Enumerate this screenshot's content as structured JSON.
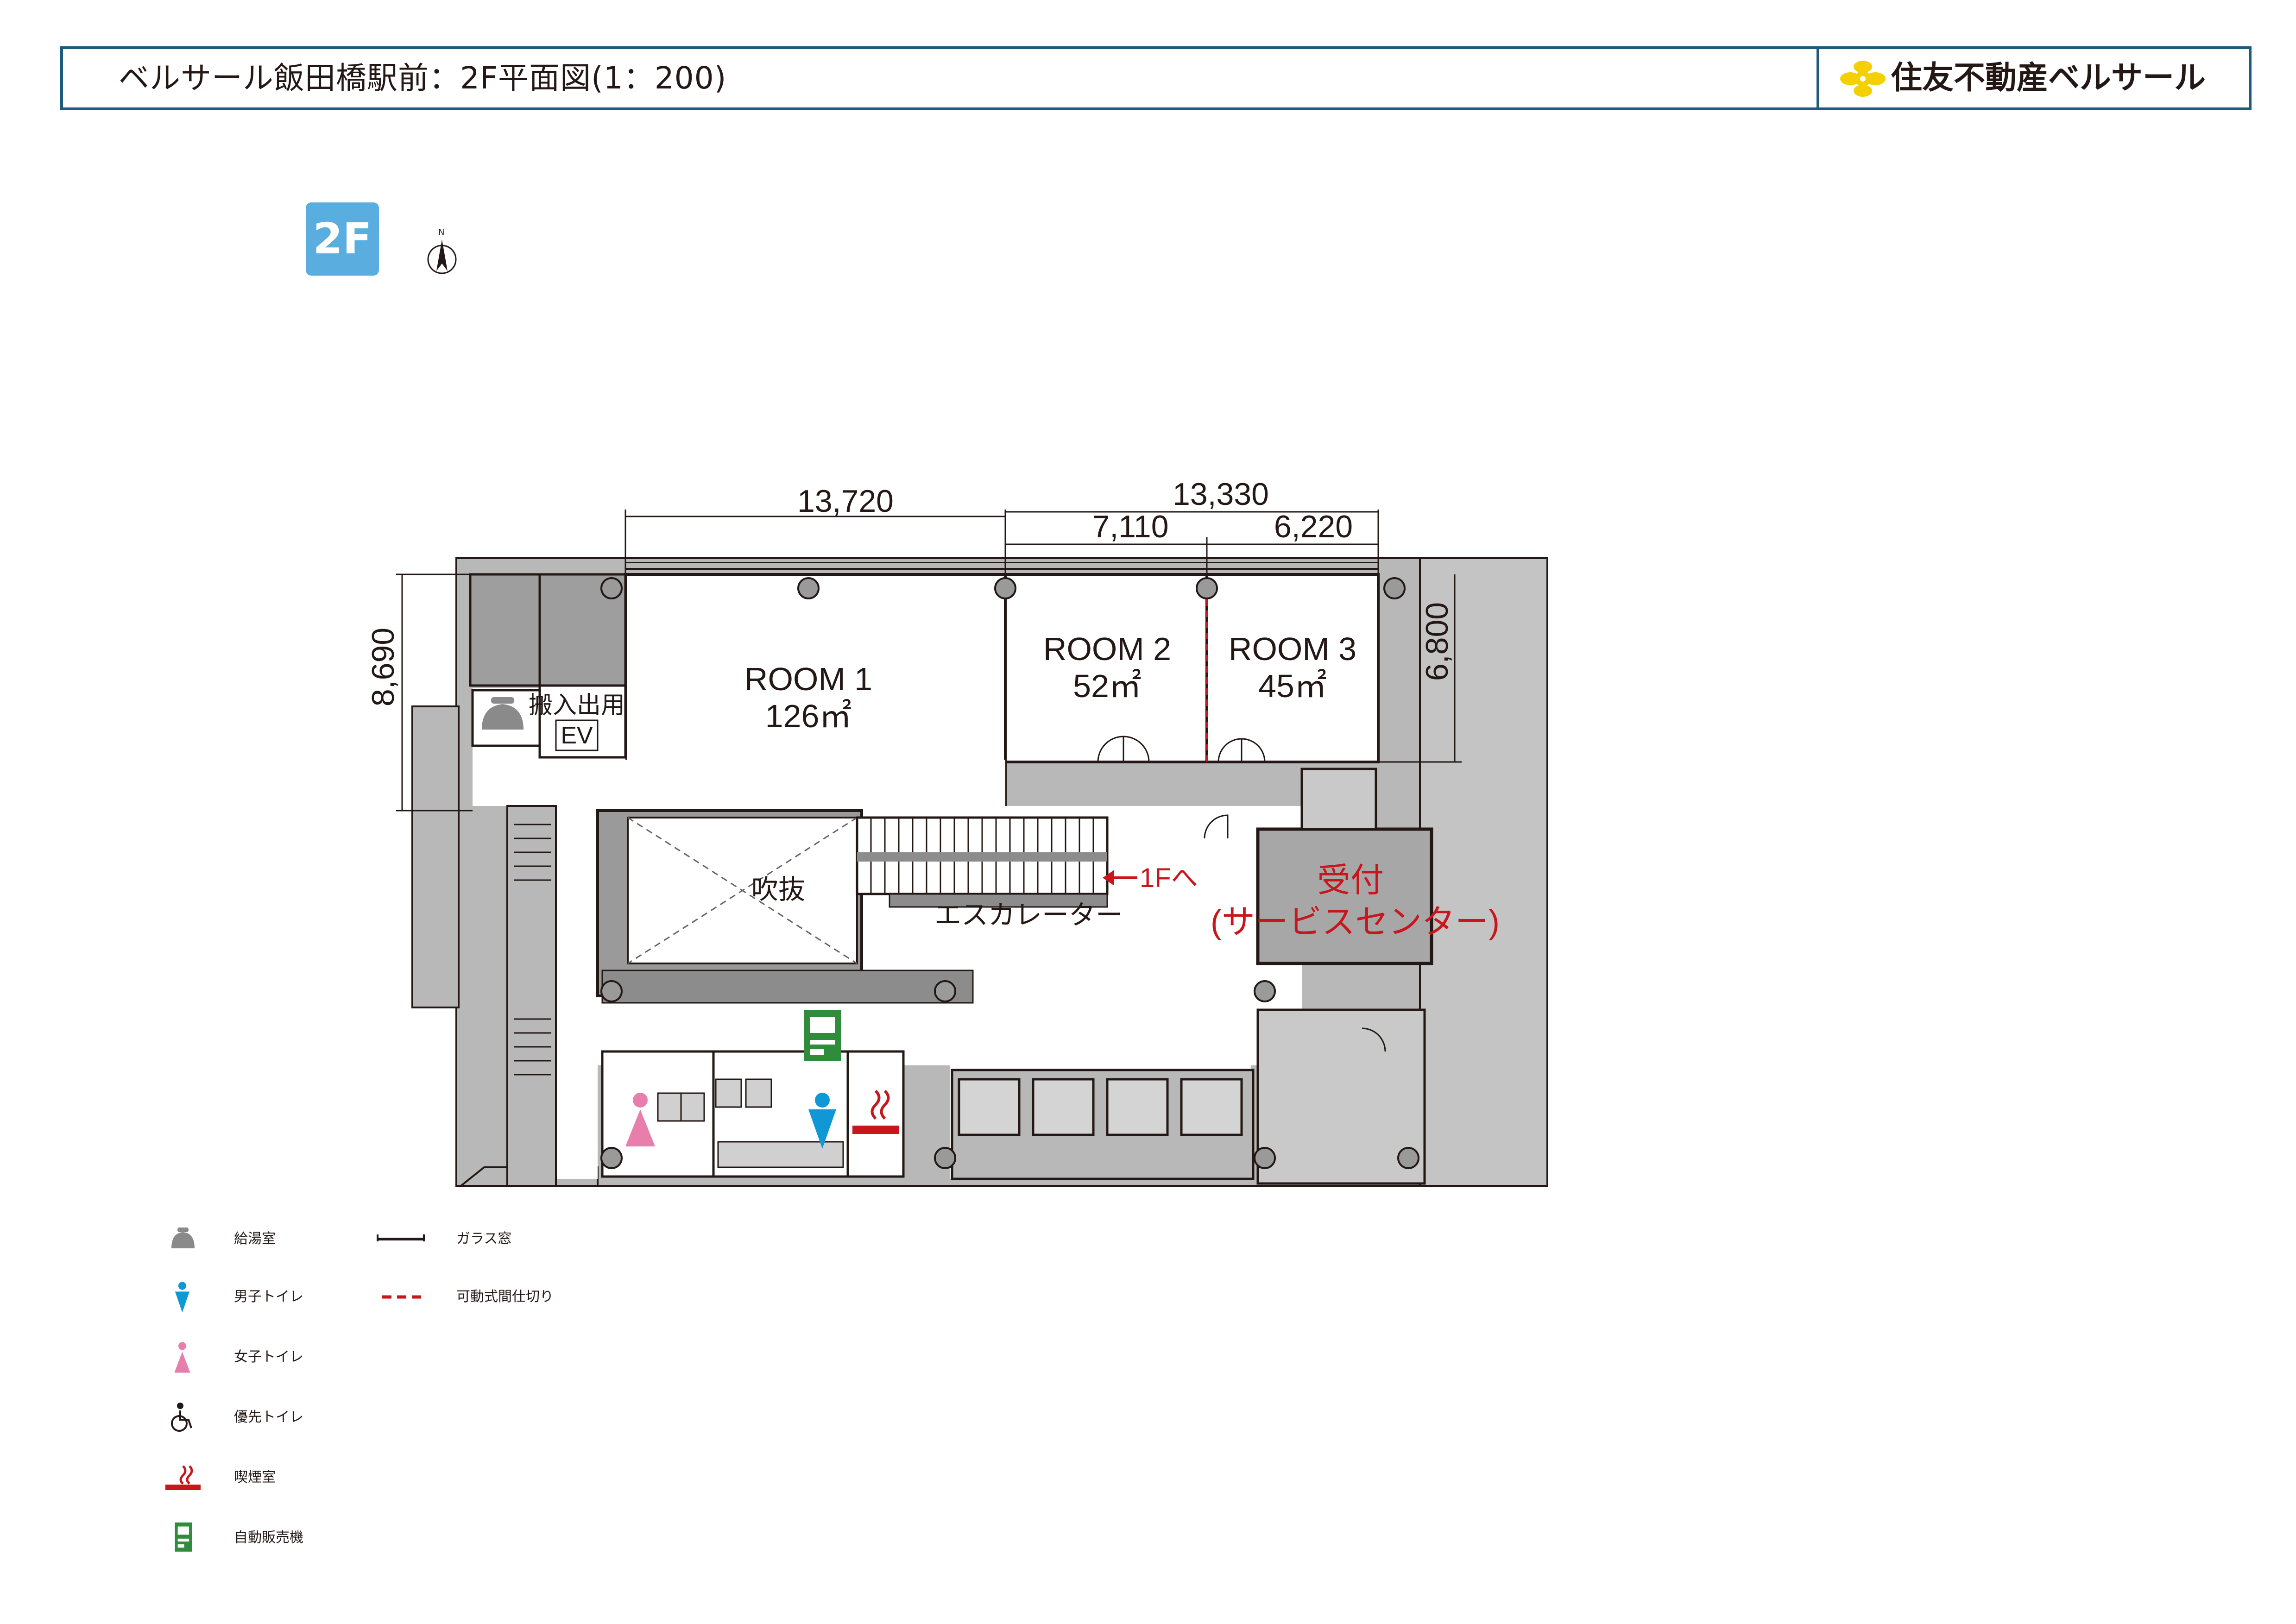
{
  "header": {
    "title": "ベルサール飯田橋駅前：2F平面図(1：200)",
    "brand_name": "住友不動産ベルサール"
  },
  "floor_badge": "2F",
  "compass": {
    "north_label": "N"
  },
  "dimensions": {
    "room1_width": "13,720",
    "room23_total_width": "13,330",
    "room2_width": "7,110",
    "room3_width": "6,220",
    "left_depth": "8,690",
    "right_depth": "6,800"
  },
  "rooms": {
    "room1_name": "ROOM 1",
    "room1_area": "126㎡",
    "room2_name": "ROOM 2",
    "room2_area": "52㎡",
    "room3_name": "ROOM 3",
    "room3_area": "45㎡"
  },
  "labels": {
    "freight_ev_line1": "搬入出用",
    "freight_ev_line2": "EV",
    "atrium": "吹抜",
    "escalator": "エスカレーター",
    "to_1f": "1Fへ",
    "reception_line1": "受付",
    "reception_line2": "(サービスセンター)"
  },
  "legend": [
    {
      "icon": "kettle-icon",
      "label": "給湯室"
    },
    {
      "icon": "men-toilet-icon",
      "label": "男子トイレ"
    },
    {
      "icon": "women-toilet-icon",
      "label": "女子トイレ"
    },
    {
      "icon": "wheelchair-icon",
      "label": "優先トイレ"
    },
    {
      "icon": "smoking-icon",
      "label": "喫煙室"
    },
    {
      "icon": "vending-machine-icon",
      "label": "自動販売機"
    },
    {
      "icon": "glass-window-line",
      "label": "ガラス窓"
    },
    {
      "icon": "movable-partition-line",
      "label": "可動式間仕切り"
    }
  ],
  "colors": {
    "header_border": "#1e5a7c",
    "floor_badge": "#5aaedf",
    "wall": "#231815",
    "shaded": "#b8b8b8",
    "reception_fill": "#a7a7a7",
    "accent_red": "#c8161d",
    "men_blue": "#0f98d5",
    "women_pink": "#e87eac",
    "vending_green": "#2e8c3a",
    "brand_yellow": "#f5d000"
  }
}
